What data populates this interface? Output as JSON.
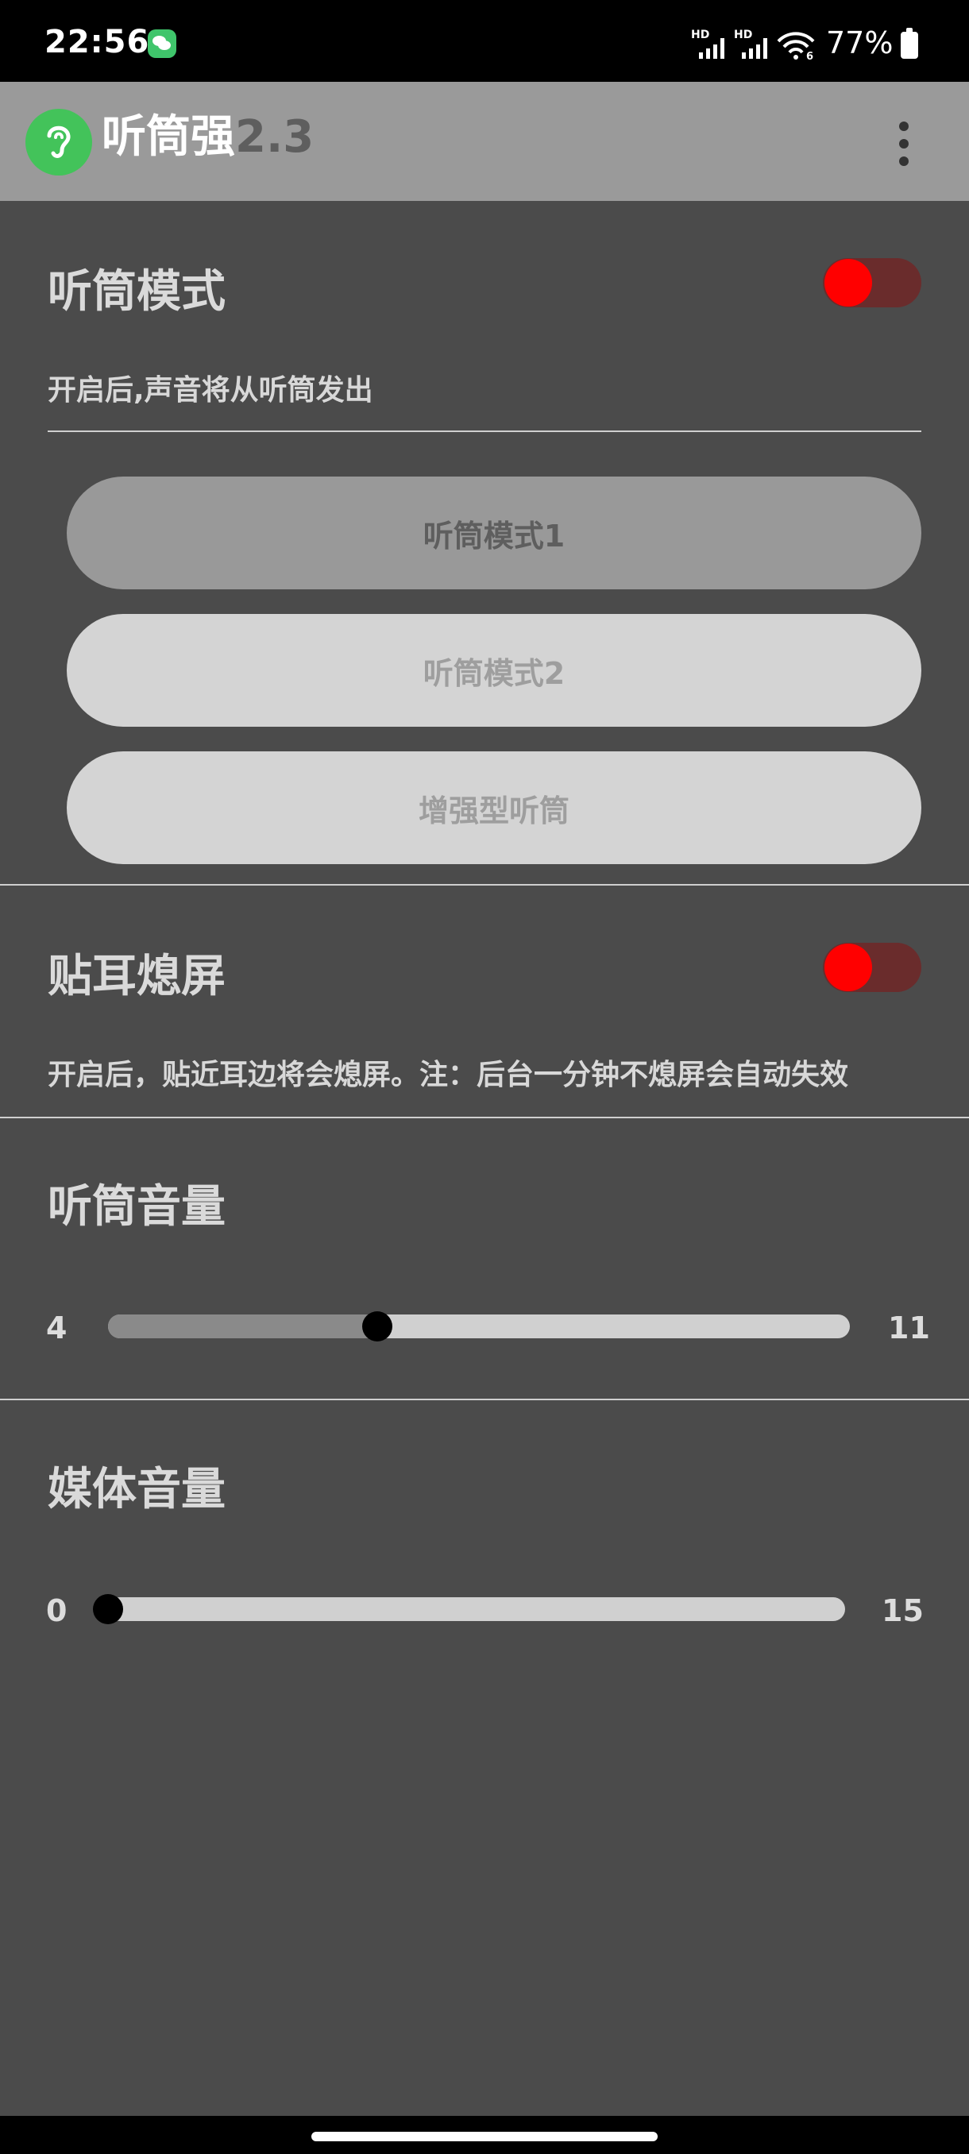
{
  "status": {
    "time": "22:56",
    "hd1": "HD",
    "hd2": "HD",
    "wifi_badge": "6",
    "battery": "77%"
  },
  "app": {
    "title": "听筒强",
    "version": "2.3"
  },
  "earpiece": {
    "title": "听筒模式",
    "description": "开启后,声音将从听筒发出",
    "switch_on": true,
    "modes": [
      {
        "label": "听筒模式1",
        "selected": true
      },
      {
        "label": "听筒模式2",
        "selected": false
      },
      {
        "label": "增强型听筒",
        "selected": false
      }
    ]
  },
  "proximity": {
    "title": "贴耳熄屏",
    "description": "开启后，贴近耳边将会熄屏。注：后台一分钟不熄屏会自动失效",
    "switch_on": true
  },
  "earpiece_volume": {
    "title": "听筒音量",
    "min": "4",
    "max": "11",
    "fraction": 0.363
  },
  "media_volume": {
    "title": "媒体音量",
    "min": "0",
    "max": "15",
    "fraction": 0.0
  },
  "colors": {
    "accent_on": "#ff0000",
    "track_on": "#6a2c2c",
    "logo": "#43c35a"
  }
}
